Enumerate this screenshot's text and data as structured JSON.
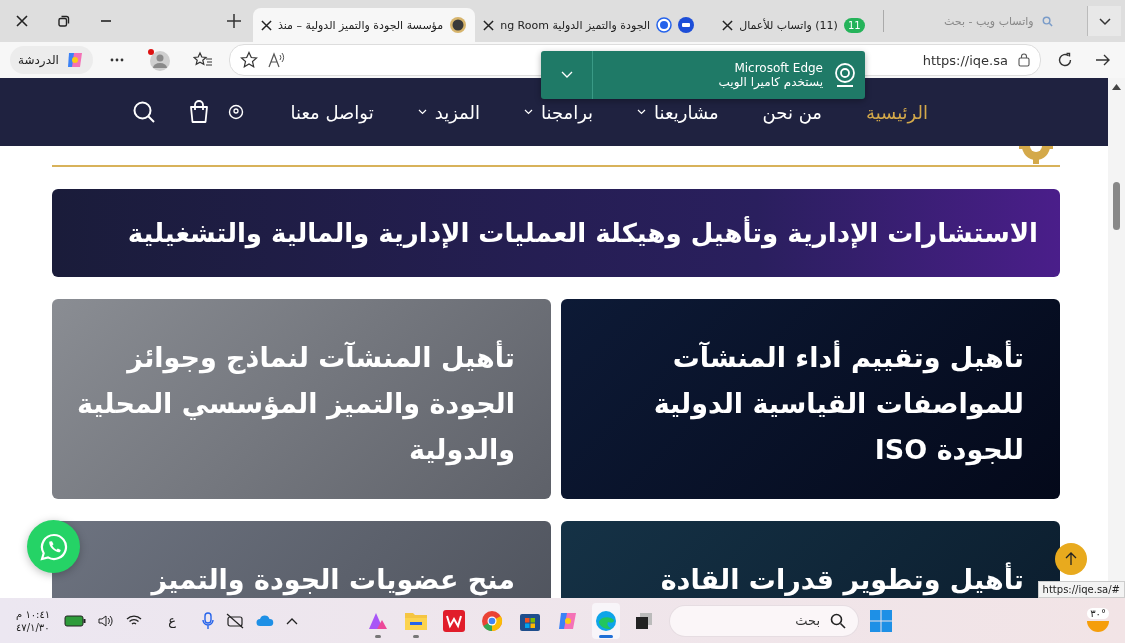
{
  "tabs": [
    {
      "title": "(11) واتساب للأعمال",
      "kind": "chat",
      "badge": "11",
      "selected": false
    },
    {
      "title": "الجودة والتميز الدولية ng Room",
      "kind": "meeting",
      "selected": false
    },
    {
      "title": "مؤسسة الجودة والتميز الدولية – منذ",
      "kind": "site",
      "selected": true
    }
  ],
  "tab_search": {
    "placeholder": "واتساب ويب - بحث"
  },
  "toolbar": {
    "chat_label": "الدردشة",
    "url": "https://iqe.sa"
  },
  "notification": {
    "title": "Microsoft Edge",
    "message": "يستخدم كاميرا الويب"
  },
  "nav": {
    "items": [
      {
        "label": "الرئيسية",
        "selected": true,
        "dropdown": false
      },
      {
        "label": "من نحن",
        "selected": false,
        "dropdown": false
      },
      {
        "label": "مشاريعنا",
        "selected": false,
        "dropdown": true
      },
      {
        "label": "برامجنا",
        "selected": false,
        "dropdown": true
      },
      {
        "label": "المزيد",
        "selected": false,
        "dropdown": true
      },
      {
        "label": "تواصل معنا",
        "selected": false,
        "dropdown": false
      }
    ]
  },
  "banner": {
    "title": "الاستشارات الإدارية وتأهيل وهيكلة العمليات الإدارية والمالية والتشغيلية"
  },
  "cards": [
    {
      "title": "تأهيل وتقييم أداء المنشآت للمواصفات القياسية الدولية للجودة ISO",
      "kind": "navy"
    },
    {
      "title": "تأهيل المنشآت لنماذج وجوائز الجودة والتميز المؤسسي المحلية والدولية",
      "kind": "grey"
    },
    {
      "title": "تأهيل وتطوير قدرات القادة",
      "kind": "teal"
    },
    {
      "title": "منح عضويات الجودة والتميز",
      "kind": "slate"
    }
  ],
  "status_url": "https://iqe.sa/#",
  "taskbar": {
    "time": "١٠:٤١ م",
    "date": "٤٧/١/٣٠",
    "language": "ع",
    "search_placeholder": "بحث",
    "weather": "٣٠°",
    "apps": [
      {
        "kind": "designer",
        "running": true,
        "selected": false
      },
      {
        "kind": "files",
        "running": true,
        "selected": false
      },
      {
        "kind": "office",
        "running": false,
        "selected": false
      },
      {
        "kind": "chrome",
        "running": false,
        "selected": false
      },
      {
        "kind": "store",
        "running": false,
        "selected": false
      },
      {
        "kind": "copilot",
        "running": false,
        "selected": false
      },
      {
        "kind": "edge",
        "running": true,
        "selected": true
      },
      {
        "kind": "taskview",
        "running": false,
        "selected": false
      }
    ]
  }
}
